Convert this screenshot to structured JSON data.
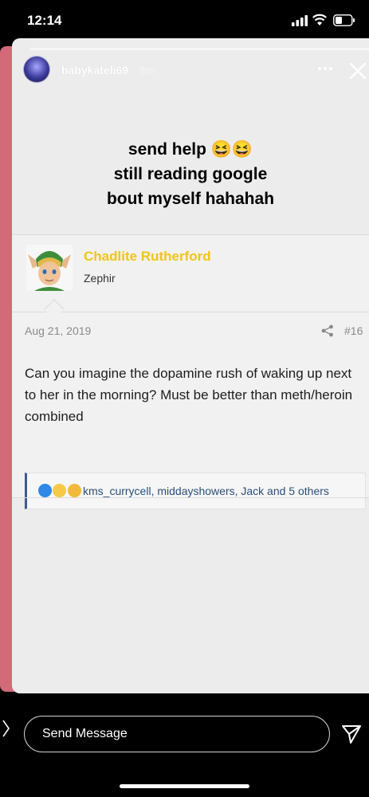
{
  "status_bar": {
    "time": "12:14"
  },
  "story": {
    "username": "babykateli69",
    "time_ago": "8m",
    "caption_lines": [
      "send help 😆😆",
      "still reading google",
      "bout myself hahahah"
    ]
  },
  "post": {
    "author": "Chadlite Rutherford",
    "user_title": "Zephir",
    "date": "Aug 21, 2019",
    "number": "#16",
    "body": "Can you imagine the dopamine rush of waking up next to her in the morning? Must be better than meth/heroin combined",
    "reactions_users": "kms_currycell, middayshowers, Jack and 5 others",
    "reaction_icons": [
      "like-icon",
      "haha-icon",
      "sad-icon"
    ],
    "author_color": "#f1c515"
  },
  "bottom_bar": {
    "message_placeholder": "Send Message"
  }
}
